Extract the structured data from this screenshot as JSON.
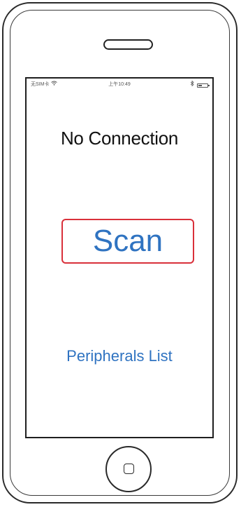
{
  "status_bar": {
    "carrier": "无SIM卡",
    "time": "上午10:49",
    "battery_level": 0.4,
    "icons": [
      "wifi-icon",
      "bluetooth-icon",
      "battery-icon"
    ]
  },
  "main": {
    "title": "No Connection",
    "scan_label": "Scan",
    "peripherals_label": "Peripherals List"
  },
  "colors": {
    "accent": "#2f73c1",
    "scan_border": "#d9303a",
    "text": "#111111"
  }
}
